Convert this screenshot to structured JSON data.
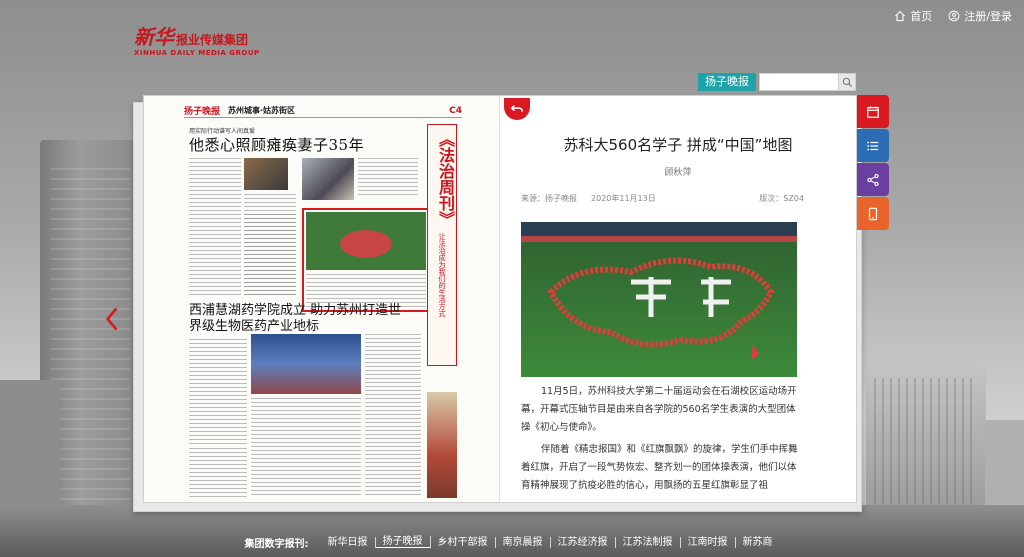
{
  "top_nav": {
    "home": "首页",
    "login": "注册/登录"
  },
  "logo": {
    "cn": "报业传媒集团",
    "mark": "新华",
    "en": "XINHUA DAILY MEDIA GROUP"
  },
  "search": {
    "paper_label": "扬子晚报",
    "placeholder": "",
    "value": ""
  },
  "newspaper": {
    "mark": "扬子晚报",
    "section": "苏州城事·姑苏街区",
    "page": "C4",
    "kicker": "用实际行动谱写人间真爱",
    "headline1": "他悉心照顾瘫痪妻子35年",
    "headline2": "西浦慧湖药学院成立 助力苏州打造世界级生物医药产业地标",
    "vertical_title": "《法治周刊》",
    "vertical_sub": "让法治成为我们的生活方式"
  },
  "article": {
    "title": "苏科大560名学子 拼成“中国”地图",
    "author": "顾秋萍",
    "source": "来源：扬子晚报",
    "date": "2020年11月13日",
    "page": "版次：SZ04",
    "paragraphs": [
      "11月5日，苏州科技大学第二十届运动会在石湖校区运动场开幕，开幕式压轴节目是由来自各学院的560名学生表演的大型团体操《初心与使命》。",
      "伴随着《精忠报国》和《红旗飘飘》的旋律，学生们手中挥舞着红旗，开启了一段气势恢宏、整齐划一的团体操表演，他们以体育精神展现了抗疫必胜的信心，用飘扬的五星红旗彰显了祖"
    ]
  },
  "side_tools": [
    "calendar-icon",
    "list-icon",
    "share-icon",
    "mobile-icon"
  ],
  "colors": {
    "red": "#d8191f",
    "blue": "#2a6db5",
    "purple": "#6b3fa0",
    "orange": "#e8642a",
    "teal": "#1ea3a8"
  },
  "footer": {
    "label": "集团数字报刊:",
    "links": [
      "新华日报",
      "扬子晚报",
      "乡村干部报",
      "南京晨报",
      "江苏经济报",
      "江苏法制报",
      "江南时报",
      "新苏商"
    ],
    "active": "扬子晚报"
  }
}
